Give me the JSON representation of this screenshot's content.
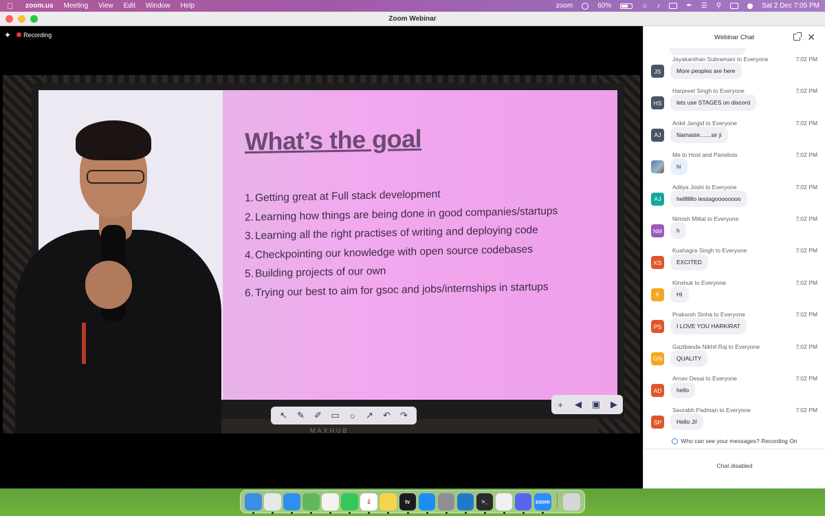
{
  "menubar": {
    "app_name": "zoom.us",
    "menus": [
      "Meeting",
      "View",
      "Edit",
      "Window",
      "Help"
    ],
    "zoom_label": "zoom",
    "battery": "60%",
    "datetime": "Sat 2 Dec  7:05 PM"
  },
  "window": {
    "title": "Zoom Webinar"
  },
  "recording": {
    "label": "Recording"
  },
  "slide": {
    "title": "What’s the goal",
    "items": [
      "Getting great at Full stack development",
      "Learning how things are being done in good companies/startups",
      "Learning all the right practises of writing and deploying code",
      "Checkpointing our knowledge with open source codebases",
      "Building projects of our own",
      "Trying our best to aim for gsoc and jobs/internships in startups"
    ],
    "numbers": [
      "1.",
      "2.",
      "3.",
      "4.",
      "5.",
      "6."
    ],
    "board_brand": "MAXHUB"
  },
  "chat": {
    "title": "Webinar Chat",
    "messages": [
      {
        "sender": "Jayakanthan Subramani to Everyone",
        "time": "7:02 PM",
        "initials": "JS",
        "color": "#4a5568",
        "text": "More peoples are here"
      },
      {
        "sender": "Harpreet Singh to Everyone",
        "time": "7:02 PM",
        "initials": "HS",
        "color": "#4a5568",
        "text": "lets use STAGES on discord"
      },
      {
        "sender": "Ankit Jangid to Everyone",
        "time": "7:02 PM",
        "initials": "AJ",
        "color": "#4a5568",
        "text": "Namaste.......sir ji"
      },
      {
        "sender": "Me to Host and Panelists",
        "time": "7:02 PM",
        "initials": "",
        "color": "#6b8aab",
        "text": "hi"
      },
      {
        "sender": "Aditya Joshi to Everyone",
        "time": "7:02 PM",
        "initials": "AJ",
        "color": "#13a89e",
        "text": "hellllllllo lesssgoooooooo"
      },
      {
        "sender": "Nimish Mittal to Everyone",
        "time": "7:02 PM",
        "initials": "NM",
        "color": "#9b59b6",
        "text": "h"
      },
      {
        "sender": "Kushagra Singh to Everyone",
        "time": "7:02 PM",
        "initials": "KS",
        "color": "#e0562b",
        "text": "EXCITED"
      },
      {
        "sender": "Kinshuk to Everyone",
        "time": "7:02 PM",
        "initials": "K",
        "color": "#f5a623",
        "text": "HI"
      },
      {
        "sender": "Prakarsh Sinha to Everyone",
        "time": "7:02 PM",
        "initials": "PS",
        "color": "#e0562b",
        "text": "I LOVE YOU HARKIRAT"
      },
      {
        "sender": "Gazibanda Nikhil Raj to Everyone",
        "time": "7:02 PM",
        "initials": "GN",
        "color": "#f5a623",
        "text": "QUALITY"
      },
      {
        "sender": "Arnav Desai to Everyone",
        "time": "7:02 PM",
        "initials": "AD",
        "color": "#e0562b",
        "text": "hello"
      },
      {
        "sender": "Saurabh Padman to Everyone",
        "time": "7:02 PM",
        "initials": "SP",
        "color": "#e0562b",
        "text": "Hello Ji!"
      }
    ],
    "privacy_notice": "Who can see your messages? Recording On",
    "status": "Chat disabled"
  },
  "dock": {
    "apps": [
      {
        "name": "finder-app",
        "color": "#3a8ee6",
        "label": ""
      },
      {
        "name": "launchpad-app",
        "color": "#e8e8ec",
        "label": ""
      },
      {
        "name": "safari-app",
        "color": "#2f8ff0",
        "label": ""
      },
      {
        "name": "maps-app",
        "color": "#5fb85a",
        "label": ""
      },
      {
        "name": "photos-app",
        "color": "#f2f2f2",
        "label": ""
      },
      {
        "name": "facetime-app",
        "color": "#34c759",
        "label": ""
      },
      {
        "name": "calendar-app",
        "color": "#ffffff",
        "label": "2"
      },
      {
        "name": "notes-app",
        "color": "#f7d34a",
        "label": ""
      },
      {
        "name": "tv-app",
        "color": "#1c1c1e",
        "label": "tv"
      },
      {
        "name": "app-store-app",
        "color": "#1e8cf5",
        "label": ""
      },
      {
        "name": "system-settings-app",
        "color": "#8e8e93",
        "label": ""
      },
      {
        "name": "vscode-app",
        "color": "#1f7acc",
        "label": ""
      },
      {
        "name": "terminal-app",
        "color": "#2b2b2b",
        "label": ">_"
      },
      {
        "name": "chrome-app",
        "color": "#f1f1f1",
        "label": ""
      },
      {
        "name": "discord-app",
        "color": "#5865f2",
        "label": ""
      },
      {
        "name": "zoom-app",
        "color": "#2d8cff",
        "label": "zoom"
      }
    ],
    "trash": {
      "name": "trash-app",
      "color": "#d6d6d8"
    }
  }
}
